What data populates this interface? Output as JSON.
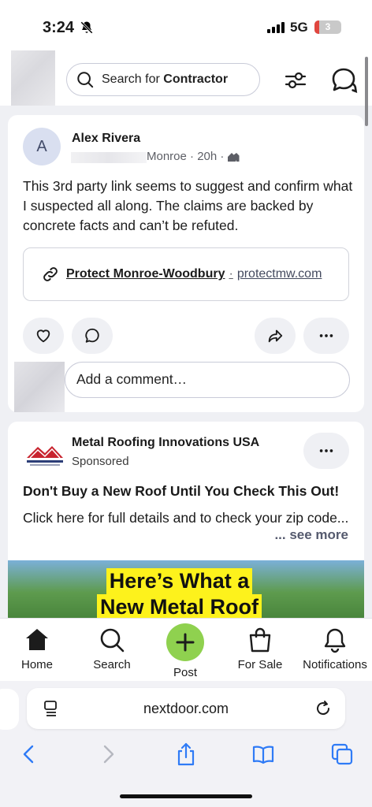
{
  "status_bar": {
    "time": "3:24",
    "network": "5G",
    "battery": "3"
  },
  "header": {
    "search_placeholder_prefix": "Search for ",
    "search_placeholder_bold": "Contractor"
  },
  "post": {
    "avatar_initial": "A",
    "author": "Alex Rivera",
    "meta": "Monroe · 20h ·",
    "body": "This 3rd party link seems to suggest and confirm what I suspected all along. The claims are backed by concrete facts and can’t be refuted.",
    "link": {
      "title": "Protect Monroe-Woodbury",
      "separator": "·",
      "domain": "protectmw.com"
    },
    "comment_placeholder": "Add a comment…"
  },
  "ad": {
    "advertiser": "Metal Roofing Innovations USA",
    "sponsored": "Sponsored",
    "headline": "Don't Buy a New Roof Until You Check This Out!",
    "text": "Click here for full details and to check your zip code...",
    "see_more": "... see more",
    "banner_line1": "Here’s What a",
    "banner_line2": "New Metal Roof"
  },
  "bottom_nav": {
    "home": "Home",
    "search": "Search",
    "post": "Post",
    "for_sale": "For Sale",
    "notifications": "Notifications"
  },
  "browser": {
    "url": "nextdoor.com"
  },
  "colors": {
    "accent_green": "#8fd14f",
    "feed_bg": "#eff0f4"
  },
  "icons": [
    "bell-slash-icon",
    "search-icon",
    "filter-icon",
    "chat-icon",
    "neighborhood-icon",
    "link-icon",
    "heart-icon",
    "comment-icon",
    "share-icon",
    "more-icon",
    "home-icon",
    "plus-icon",
    "bag-icon",
    "bell-icon",
    "reader-icon",
    "reload-icon",
    "back-icon",
    "forward-icon",
    "share-sheet-icon",
    "bookmarks-icon",
    "tabs-icon"
  ]
}
